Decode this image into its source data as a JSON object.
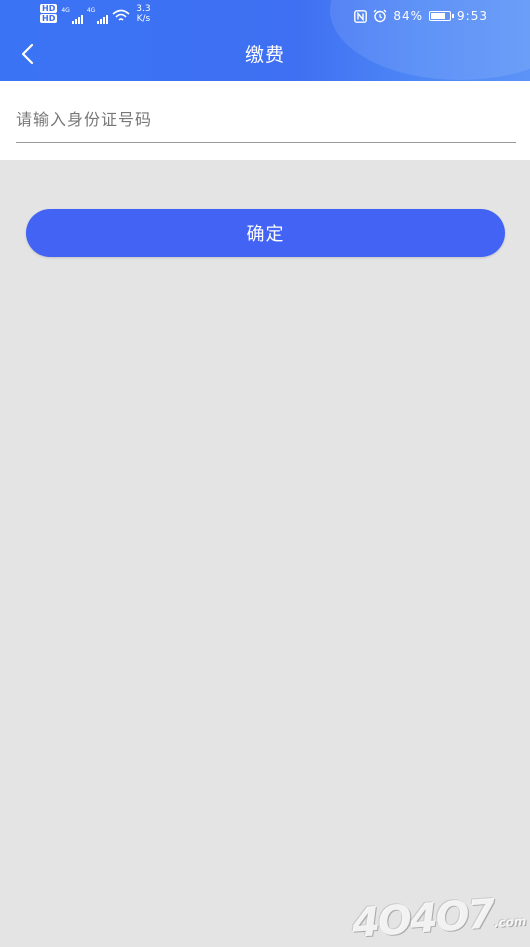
{
  "status_bar": {
    "hd1": "HD",
    "hd2": "HD",
    "net1": "4G",
    "net2": "4G",
    "speed_value": "3.3",
    "speed_unit": "K/s",
    "battery_percent": "84%",
    "battery_level": 0.84,
    "time": "9:53"
  },
  "nav": {
    "title": "缴费"
  },
  "form": {
    "id_input_placeholder": "请输入身份证号码",
    "id_input_value": ""
  },
  "confirm_button": {
    "label": "确定"
  },
  "watermark": {
    "text": "4О4О7",
    "suffix": ".com"
  },
  "colors": {
    "header": "#3f6ff2",
    "button": "#4263f4",
    "background": "#e4e4e4"
  }
}
